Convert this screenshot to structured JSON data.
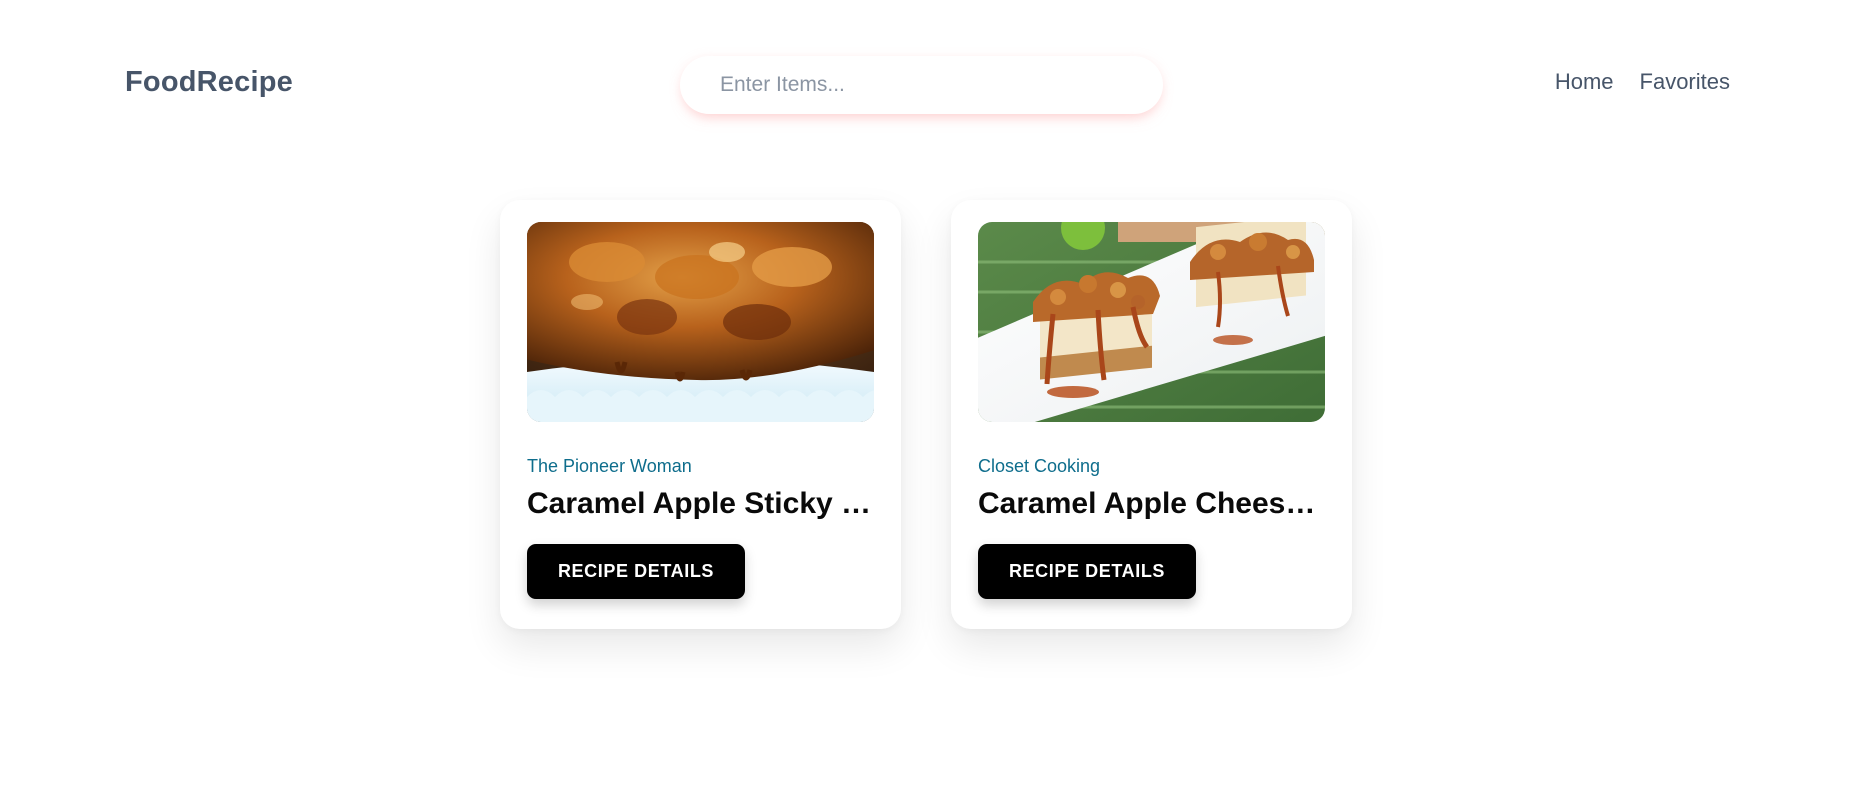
{
  "navbar": {
    "brand": "FoodRecipe",
    "search": {
      "placeholder": "Enter Items...",
      "value": ""
    },
    "links": [
      {
        "label": "Home"
      },
      {
        "label": "Favorites"
      }
    ]
  },
  "recipes": [
    {
      "publisher": "The Pioneer Woman",
      "title": "Caramel Apple Sticky Buns",
      "button_label": "RECIPE DETAILS",
      "image_icon": "photo-caramel-sticky-buns"
    },
    {
      "publisher": "Closet Cooking",
      "title": "Caramel Apple Cheesecake Bars",
      "button_label": "RECIPE DETAILS",
      "image_icon": "photo-caramel-cheesecake-bars"
    }
  ],
  "colors": {
    "brand_text": "#475569",
    "publisher_text": "#0e6d8c",
    "button_bg": "#000000",
    "search_glow": "#fecaca"
  }
}
